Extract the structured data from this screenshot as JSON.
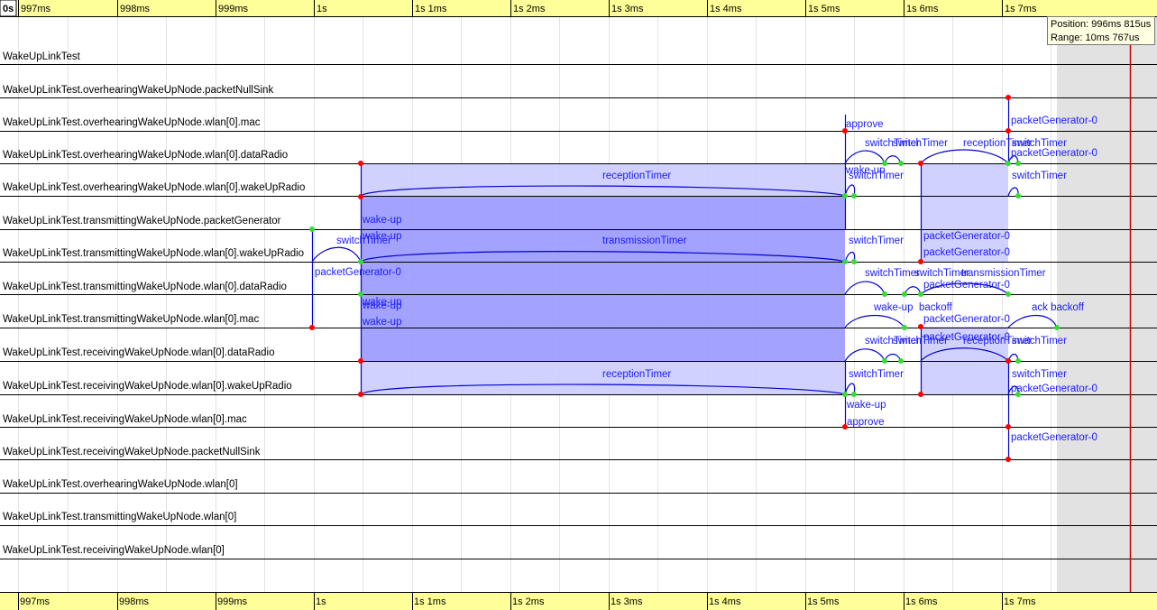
{
  "timeline": {
    "origin_label": "0s",
    "ticks": [
      "997ms",
      "998ms",
      "999ms",
      "1s",
      "1s 1ms",
      "1s 2ms",
      "1s 3ms",
      "1s 4ms",
      "1s 5ms",
      "1s 6ms",
      "1s 7ms"
    ],
    "bottom_ticks": [
      "997ms",
      "998ms",
      "999ms",
      "1s",
      "1s 1ms",
      "1s 2ms",
      "1s 3ms",
      "1s 4ms",
      "1s 5ms",
      "1s 6ms",
      "1s 7ms"
    ]
  },
  "tooltip": {
    "position": "Position: 996ms 815us",
    "range": "Range: 10ms 767us"
  },
  "lanes": [
    "WakeUpLinkTest",
    "WakeUpLinkTest.overhearingWakeUpNode.packetNullSink",
    "WakeUpLinkTest.overhearingWakeUpNode.wlan[0].mac",
    "WakeUpLinkTest.overhearingWakeUpNode.wlan[0].dataRadio",
    "WakeUpLinkTest.overhearingWakeUpNode.wlan[0].wakeUpRadio",
    "WakeUpLinkTest.transmittingWakeUpNode.packetGenerator",
    "WakeUpLinkTest.transmittingWakeUpNode.wlan[0].wakeUpRadio",
    "WakeUpLinkTest.transmittingWakeUpNode.wlan[0].dataRadio",
    "WakeUpLinkTest.transmittingWakeUpNode.wlan[0].mac",
    "WakeUpLinkTest.receivingWakeUpNode.wlan[0].dataRadio",
    "WakeUpLinkTest.receivingWakeUpNode.wlan[0].wakeUpRadio",
    "WakeUpLinkTest.receivingWakeUpNode.wlan[0].mac",
    "WakeUpLinkTest.receivingWakeUpNode.packetNullSink",
    "WakeUpLinkTest.overhearingWakeUpNode.wlan[0]",
    "WakeUpLinkTest.transmittingWakeUpNode.wlan[0]",
    "WakeUpLinkTest.receivingWakeUpNode.wlan[0]"
  ],
  "event_labels": [
    {
      "text": "approve"
    },
    {
      "text": "packetGenerator-0"
    },
    {
      "text": "switchTimer"
    },
    {
      "text": "switchTimer"
    },
    {
      "text": "receptionTimer"
    },
    {
      "text": "switchTimer"
    },
    {
      "text": "packetGenerator-0"
    },
    {
      "text": "receptionTimer"
    },
    {
      "text": "wake-up"
    },
    {
      "text": "switchTimer"
    },
    {
      "text": "switchTimer"
    },
    {
      "text": "wake-up"
    },
    {
      "text": "wake-up"
    },
    {
      "text": "switchTimer"
    },
    {
      "text": "transmissionTimer"
    },
    {
      "text": "switchTimer"
    },
    {
      "text": "packetGenerator-0"
    },
    {
      "text": "packetGenerator-0"
    },
    {
      "text": "packetGenerator-0"
    },
    {
      "text": "switchTimer"
    },
    {
      "text": "switchTimer"
    },
    {
      "text": "transmissionTimer"
    },
    {
      "text": "packetGenerator-0"
    },
    {
      "text": "wake-up"
    },
    {
      "text": "wake-up"
    },
    {
      "text": "wake-up"
    },
    {
      "text": "wake-up"
    },
    {
      "text": "backoff"
    },
    {
      "text": "ack backoff"
    },
    {
      "text": "packetGenerator-0"
    },
    {
      "text": "packetGenerator-0"
    },
    {
      "text": "switchTimer"
    },
    {
      "text": "switchTimer"
    },
    {
      "text": "receptionTimer"
    },
    {
      "text": "switchTimer"
    },
    {
      "text": "receptionTimer"
    },
    {
      "text": "switchTimer"
    },
    {
      "text": "switchTimer"
    },
    {
      "text": "packetGenerator-0"
    },
    {
      "text": "wake-up"
    },
    {
      "text": "approve"
    },
    {
      "text": "packetGenerator-0"
    }
  ],
  "colors": {
    "ruler_bg": "#ffff99",
    "lane_line": "#000000",
    "grid": "#e3e3e3",
    "band_dark": "#9999ff",
    "band_light": "#ccccff",
    "arrow": "#0000cc",
    "dot_red": "#ff0000",
    "dot_green": "#33dd33",
    "cursor": "#cc0000",
    "shade": "#e2e2e2"
  }
}
